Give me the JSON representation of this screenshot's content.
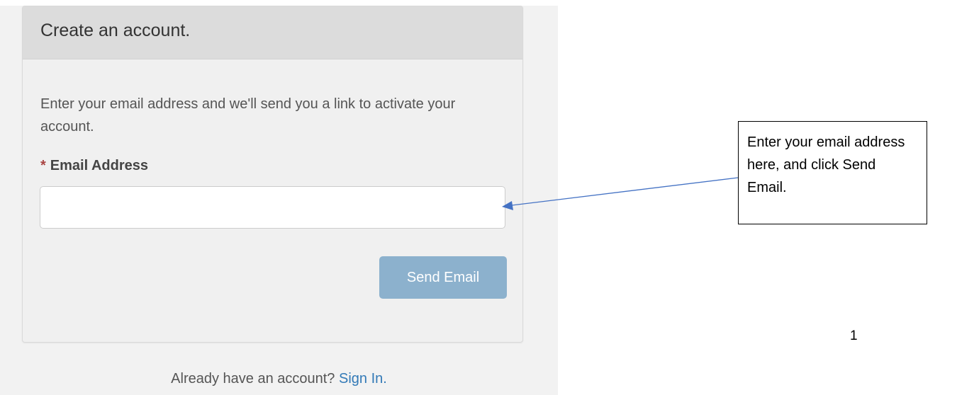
{
  "panel": {
    "title": "Create an account.",
    "intro": "Enter your email address and we'll send you a link to activate your account.",
    "field": {
      "required_mark": "*",
      "label": "Email Address",
      "value": "",
      "placeholder": ""
    },
    "send_button_label": "Send Email"
  },
  "footer": {
    "prompt": "Already have an account?",
    "signin_link": "Sign In."
  },
  "annotation": {
    "text": "Enter your email address here, and click Send Email.",
    "page_number": "1"
  },
  "colors": {
    "button": "#8cb1cd",
    "link": "#337ab7",
    "required": "#a94442",
    "arrow": "#4472c4"
  }
}
